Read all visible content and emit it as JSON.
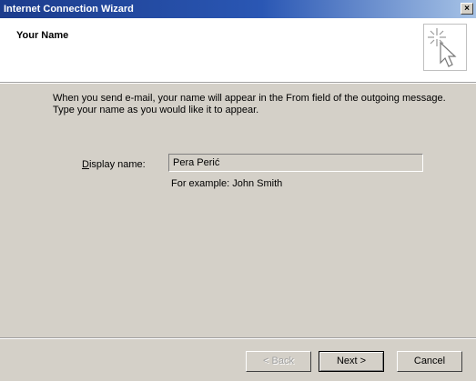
{
  "window": {
    "title": "Internet Connection Wizard",
    "close_label": "×"
  },
  "header": {
    "title": "Your Name",
    "art_icon": "wizard-cursor-sparkle-icon"
  },
  "main": {
    "description": "When you send e-mail, your name will appear in the From field of the outgoing message. Type your name as you would like it to appear.",
    "display_name": {
      "label_mnemonic": "D",
      "label_rest": "isplay name:",
      "value": "Pera Perić",
      "example": "For example: John Smith"
    }
  },
  "footer": {
    "back_label": "< Back",
    "next_label": "Next >",
    "cancel_label": "Cancel"
  }
}
